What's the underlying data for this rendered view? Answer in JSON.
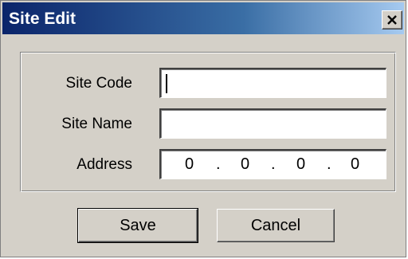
{
  "window": {
    "title": "Site Edit"
  },
  "titlebar": {
    "close_glyph": "close-icon"
  },
  "form": {
    "site_code": {
      "label": "Site Code",
      "value": ""
    },
    "site_name": {
      "label": "Site Name",
      "value": ""
    },
    "address": {
      "label": "Address",
      "octets": [
        "0",
        "0",
        "0",
        "0"
      ],
      "separator": "."
    }
  },
  "buttons": {
    "save_label": "Save",
    "cancel_label": "Cancel"
  },
  "colors": {
    "title_start": "#0a246a",
    "title_end": "#a6caf0",
    "face": "#d4d0c8"
  }
}
